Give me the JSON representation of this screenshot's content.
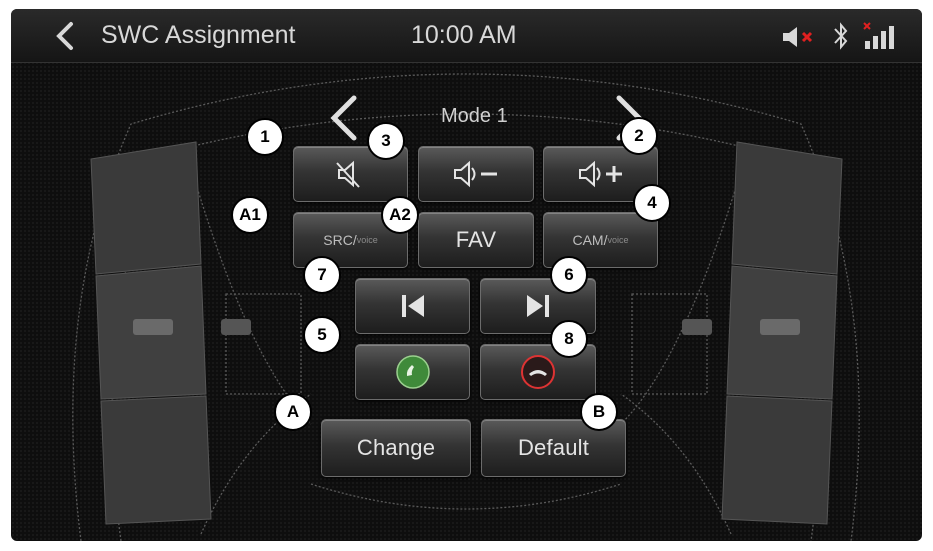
{
  "header": {
    "title": "SWC Assignment",
    "time": "10:00 AM",
    "icons": [
      "back-chevron-icon",
      "speaker-muted-icon",
      "bluetooth-icon",
      "signal-bars-icon"
    ]
  },
  "mode": {
    "label": "Mode 1"
  },
  "buttons": {
    "mute": {
      "icon": "speaker-muted-icon"
    },
    "vol_down": {
      "icon": "volume-down-icon"
    },
    "vol_up": {
      "icon": "volume-up-icon"
    },
    "src": {
      "label": "SRC/",
      "sub": "voice"
    },
    "fav": {
      "label": "FAV"
    },
    "cam": {
      "label": "CAM/",
      "sub": "voice"
    },
    "prev": {
      "icon": "skip-previous-icon"
    },
    "next": {
      "icon": "skip-next-icon"
    },
    "call": {
      "icon": "call-accept-icon",
      "color": "#3f8a3a"
    },
    "hangup": {
      "icon": "call-end-icon",
      "color": "#c9302c"
    },
    "change": {
      "label": "Change"
    },
    "default": {
      "label": "Default"
    }
  },
  "callouts": [
    "1",
    "2",
    "3",
    "4",
    "A1",
    "A2",
    "7",
    "6",
    "5",
    "8",
    "A",
    "B"
  ]
}
